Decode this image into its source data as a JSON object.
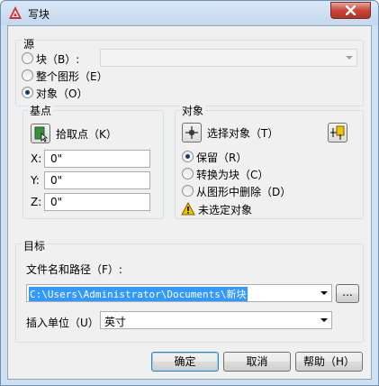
{
  "window": {
    "title": "写块"
  },
  "source": {
    "heading": "源",
    "block_label": "块（B）:",
    "whole_drawing_label": "整个图形（E）",
    "objects_label": "对象（O）",
    "selected": "objects"
  },
  "base_point": {
    "heading": "基点",
    "pick_button_label": "拾取点（K）",
    "x_label": "X:",
    "y_label": "Y:",
    "z_label": "Z:",
    "x_value": "0\"",
    "y_value": "0\"",
    "z_value": "0\""
  },
  "objects": {
    "heading": "对象",
    "select_button_label": "选择对象（T）",
    "retain_label": "保留（R）",
    "convert_label": "转换为块（C）",
    "delete_label": "从图形中删除（D）",
    "selected": "retain",
    "warning_text": "未选定对象"
  },
  "destination": {
    "heading": "目标",
    "file_label": "文件名和路径（F）:",
    "file_path": "C:\\Users\\Administrator\\Documents\\新块",
    "browse_label": "...",
    "units_label": "插入单位（U）:",
    "units_value": "英寸"
  },
  "buttons": {
    "ok_label": "确定",
    "cancel_label": "取消",
    "help_label": "帮助（H）"
  },
  "colors": {
    "accent": "#3399ff",
    "warning": "#f2c200",
    "close_button": "#c7463a"
  }
}
